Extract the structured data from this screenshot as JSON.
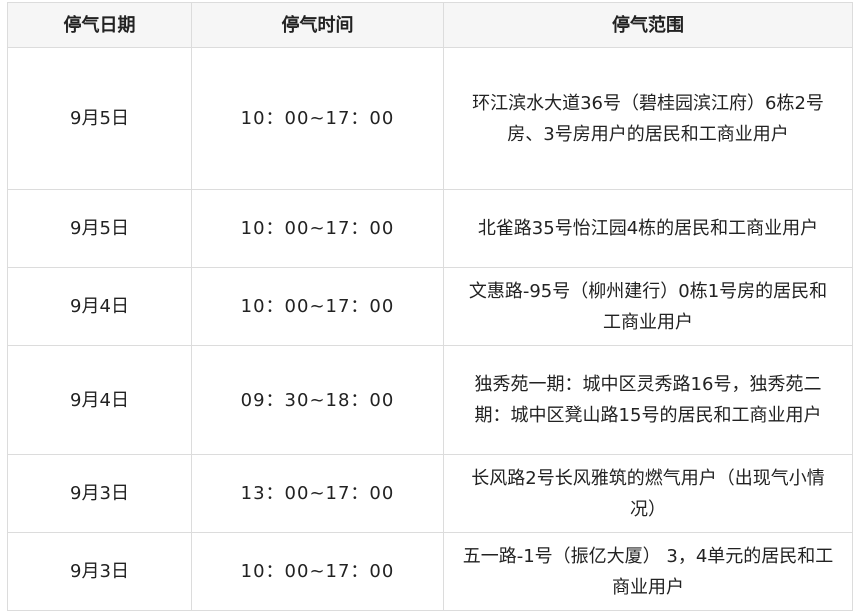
{
  "table": {
    "headers": [
      "停气日期",
      "停气时间",
      "停气范围"
    ],
    "rows": [
      {
        "date": "9月5日",
        "time": "10：00~17：00",
        "scope": "环江滨水大道36号（碧桂园滨江府）6栋2号房、3号房用户的居民和工商业用户"
      },
      {
        "date": "9月5日",
        "time": "10：00~17：00",
        "scope": "北雀路35号怡江园4栋的居民和工商业用户"
      },
      {
        "date": "9月4日",
        "time": "10：00~17：00",
        "scope": "文惠路-95号（柳州建行）0栋1号房的居民和工商业用户"
      },
      {
        "date": "9月4日",
        "time": "09：30~18：00",
        "scope": "独秀苑一期：城中区灵秀路16号，独秀苑二期：城中区凳山路15号的居民和工商业用户"
      },
      {
        "date": "9月3日",
        "time": "13：00~17：00",
        "scope": "长风路2号长风雅筑的燃气用户（出现气小情况）"
      },
      {
        "date": "9月3日",
        "time": "10：00~17：00",
        "scope": "五一路-1号（振亿大厦） 3，4单元的居民和工商业用户"
      }
    ]
  }
}
